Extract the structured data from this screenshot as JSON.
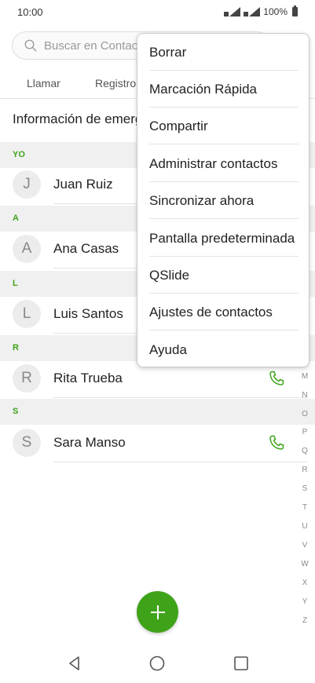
{
  "status": {
    "time": "10:00",
    "battery": "100%"
  },
  "search": {
    "placeholder": "Buscar en Contactos"
  },
  "tabs": [
    {
      "label": "Llamar"
    },
    {
      "label": "Registro"
    }
  ],
  "emergency": {
    "label": "Información de emergencia"
  },
  "sections": [
    {
      "header": "YO",
      "contacts": [
        {
          "initial": "J",
          "name": "Juan Ruiz"
        }
      ]
    },
    {
      "header": "A",
      "contacts": [
        {
          "initial": "A",
          "name": "Ana Casas"
        }
      ]
    },
    {
      "header": "L",
      "contacts": [
        {
          "initial": "L",
          "name": "Luis Santos"
        }
      ]
    },
    {
      "header": "R",
      "contacts": [
        {
          "initial": "R",
          "name": "Rita Trueba"
        }
      ]
    },
    {
      "header": "S",
      "contacts": [
        {
          "initial": "S",
          "name": "Sara Manso"
        }
      ]
    }
  ],
  "alphabet_index": [
    "M",
    "N",
    "O",
    "P",
    "Q",
    "R",
    "S",
    "T",
    "U",
    "V",
    "W",
    "X",
    "Y",
    "Z"
  ],
  "menu": {
    "items": [
      {
        "label": "Borrar"
      },
      {
        "label": "Marcación Rápida"
      },
      {
        "label": "Compartir"
      },
      {
        "label": "Administrar contactos"
      },
      {
        "label": "Sincronizar ahora"
      },
      {
        "label": "Pantalla predeterminada"
      },
      {
        "label": "QSlide"
      },
      {
        "label": "Ajustes de contactos"
      },
      {
        "label": "Ayuda"
      }
    ]
  },
  "fab": {
    "icon": "plus-icon"
  },
  "colors": {
    "accent": "#3fa31a",
    "section_bg": "#f0f0f0"
  }
}
